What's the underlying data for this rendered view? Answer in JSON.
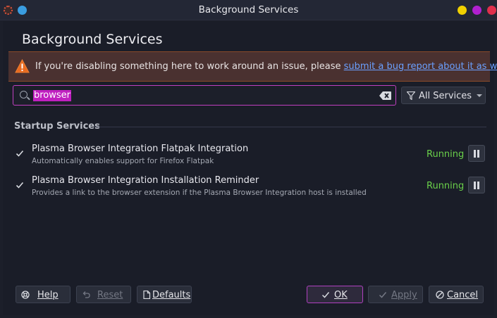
{
  "window": {
    "title": "Background Services",
    "controls": {
      "minimize": "minimize-button",
      "maximize": "maximize-button",
      "close": "close-button"
    }
  },
  "heading": "Background Services",
  "banner": {
    "icon": "warning-icon",
    "text": "If you're disabling something here to work around an issue, please ",
    "link": "submit a bug report about it as well."
  },
  "search": {
    "icon": "search-icon",
    "value": "browser",
    "clear_icon": "clear-text-icon"
  },
  "filter": {
    "icon": "funnel-icon",
    "label": "All Services"
  },
  "section": {
    "label": "Startup Services"
  },
  "services": [
    {
      "name": "Plasma Browser Integration Flatpak Integration",
      "description": "Automatically enables support for Firefox Flatpak",
      "checked": true,
      "status": "Running"
    },
    {
      "name": "Plasma Browser Integration Installation Reminder",
      "description": "Provides a link to the browser extension if the Plasma Browser Integration host is installed",
      "checked": true,
      "status": "Running"
    }
  ],
  "footer": {
    "help": "Help",
    "reset": "Reset",
    "defaults": "Defaults",
    "ok": "OK",
    "apply": "Apply",
    "cancel": "Cancel"
  },
  "colors": {
    "accent": "#c040c0",
    "running": "#6ad04a",
    "link": "#6aa0ff",
    "warning": "#e86a20"
  }
}
